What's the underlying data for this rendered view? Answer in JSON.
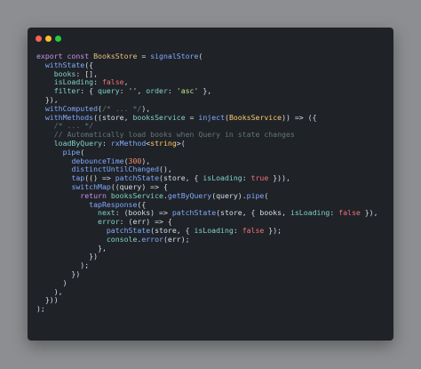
{
  "window": {
    "traffic_lights": [
      {
        "name": "close-dot",
        "color": "#ff5f56"
      },
      {
        "name": "minimize-dot",
        "color": "#ffbd2e"
      },
      {
        "name": "maximize-dot",
        "color": "#27c93f"
      }
    ],
    "background": "#1f2227"
  },
  "palette": {
    "kw": "#c792ea",
    "def": "#e6c07b",
    "key": "#7fd4c6",
    "bool": "#f07178",
    "fn": "#82aaff",
    "num": "#f78c6c",
    "str": "#c3e88d",
    "cmt": "#637777",
    "p": "#d6deeb",
    "type": "#ffcb6b"
  },
  "code": {
    "lines": [
      [
        [
          "export const ",
          "kw"
        ],
        [
          "BooksStore",
          "def"
        ],
        [
          " = ",
          "p"
        ],
        [
          "signalStore",
          "fn"
        ],
        [
          "(",
          "p"
        ]
      ],
      [
        [
          "  ",
          "p"
        ],
        [
          "withState",
          "fn"
        ],
        [
          "({",
          "p"
        ]
      ],
      [
        [
          "    ",
          "p"
        ],
        [
          "books",
          "key"
        ],
        [
          ": [],",
          "p"
        ]
      ],
      [
        [
          "    ",
          "p"
        ],
        [
          "isLoading",
          "key"
        ],
        [
          ": ",
          "p"
        ],
        [
          "false",
          "bool"
        ],
        [
          ",",
          "p"
        ]
      ],
      [
        [
          "    ",
          "p"
        ],
        [
          "filter",
          "key"
        ],
        [
          ": { ",
          "p"
        ],
        [
          "query",
          "key"
        ],
        [
          ": ",
          "p"
        ],
        [
          "''",
          "str"
        ],
        [
          ", ",
          "p"
        ],
        [
          "order",
          "key"
        ],
        [
          ": ",
          "p"
        ],
        [
          "'asc'",
          "str"
        ],
        [
          " },",
          "p"
        ]
      ],
      [
        [
          "  }),",
          "p"
        ]
      ],
      [
        [
          "  ",
          "p"
        ],
        [
          "withComputed",
          "fn"
        ],
        [
          "(",
          "p"
        ],
        [
          "/* ... */",
          "cmt"
        ],
        [
          "),",
          "p"
        ]
      ],
      [
        [
          "  ",
          "p"
        ],
        [
          "withMethods",
          "fn"
        ],
        [
          "((store, ",
          "p"
        ],
        [
          "booksService",
          "key"
        ],
        [
          " = ",
          "p"
        ],
        [
          "inject",
          "fn"
        ],
        [
          "(",
          "p"
        ],
        [
          "BooksService",
          "type"
        ],
        [
          ")) => ({",
          "p"
        ]
      ],
      [
        [
          "    ",
          "p"
        ],
        [
          "/* ... */",
          "cmt"
        ]
      ],
      [
        [
          "    ",
          "p"
        ],
        [
          "// Automatically load books when Query in state changes",
          "cmt"
        ]
      ],
      [
        [
          "    ",
          "p"
        ],
        [
          "loadByQuery",
          "key"
        ],
        [
          ": ",
          "p"
        ],
        [
          "rxMethod",
          "fn"
        ],
        [
          "<",
          "p"
        ],
        [
          "string",
          "type"
        ],
        [
          ">(",
          "p"
        ]
      ],
      [
        [
          "      ",
          "p"
        ],
        [
          "pipe",
          "fn"
        ],
        [
          "(",
          "p"
        ]
      ],
      [
        [
          "        ",
          "p"
        ],
        [
          "debounceTime",
          "fn"
        ],
        [
          "(",
          "p"
        ],
        [
          "300",
          "num"
        ],
        [
          "),",
          "p"
        ]
      ],
      [
        [
          "        ",
          "p"
        ],
        [
          "distinctUntilChanged",
          "fn"
        ],
        [
          "(),",
          "p"
        ]
      ],
      [
        [
          "        ",
          "p"
        ],
        [
          "tap",
          "fn"
        ],
        [
          "(() => ",
          "p"
        ],
        [
          "patchState",
          "fn"
        ],
        [
          "(store, { ",
          "p"
        ],
        [
          "isLoading",
          "key"
        ],
        [
          ": ",
          "p"
        ],
        [
          "true",
          "bool"
        ],
        [
          " })),",
          "p"
        ]
      ],
      [
        [
          "        ",
          "p"
        ],
        [
          "switchMap",
          "fn"
        ],
        [
          "((query) => {",
          "p"
        ]
      ],
      [
        [
          "          ",
          "p"
        ],
        [
          "return ",
          "kw"
        ],
        [
          "booksService",
          "key"
        ],
        [
          ".",
          "p"
        ],
        [
          "getByQuery",
          "fn"
        ],
        [
          "(query).",
          "p"
        ],
        [
          "pipe",
          "fn"
        ],
        [
          "(",
          "p"
        ]
      ],
      [
        [
          "            ",
          "p"
        ],
        [
          "tapResponse",
          "fn"
        ],
        [
          "({",
          "p"
        ]
      ],
      [
        [
          "              ",
          "p"
        ],
        [
          "next",
          "key"
        ],
        [
          ": (books) => ",
          "p"
        ],
        [
          "patchState",
          "fn"
        ],
        [
          "(store, { books, ",
          "p"
        ],
        [
          "isLoading",
          "key"
        ],
        [
          ": ",
          "p"
        ],
        [
          "false",
          "bool"
        ],
        [
          " }),",
          "p"
        ]
      ],
      [
        [
          "              ",
          "p"
        ],
        [
          "error",
          "key"
        ],
        [
          ": (err) => {",
          "p"
        ]
      ],
      [
        [
          "                ",
          "p"
        ],
        [
          "patchState",
          "fn"
        ],
        [
          "(store, { ",
          "p"
        ],
        [
          "isLoading",
          "key"
        ],
        [
          ": ",
          "p"
        ],
        [
          "false",
          "bool"
        ],
        [
          " });",
          "p"
        ]
      ],
      [
        [
          "                ",
          "p"
        ],
        [
          "console",
          "key"
        ],
        [
          ".",
          "p"
        ],
        [
          "error",
          "fn"
        ],
        [
          "(err);",
          "p"
        ]
      ],
      [
        [
          "              },",
          "p"
        ]
      ],
      [
        [
          "            })",
          "p"
        ]
      ],
      [
        [
          "          );",
          "p"
        ]
      ],
      [
        [
          "        })",
          "p"
        ]
      ],
      [
        [
          "      )",
          "p"
        ]
      ],
      [
        [
          "    ),",
          "p"
        ]
      ],
      [
        [
          "  }))",
          "p"
        ]
      ],
      [
        [
          ");",
          "p"
        ]
      ]
    ]
  }
}
